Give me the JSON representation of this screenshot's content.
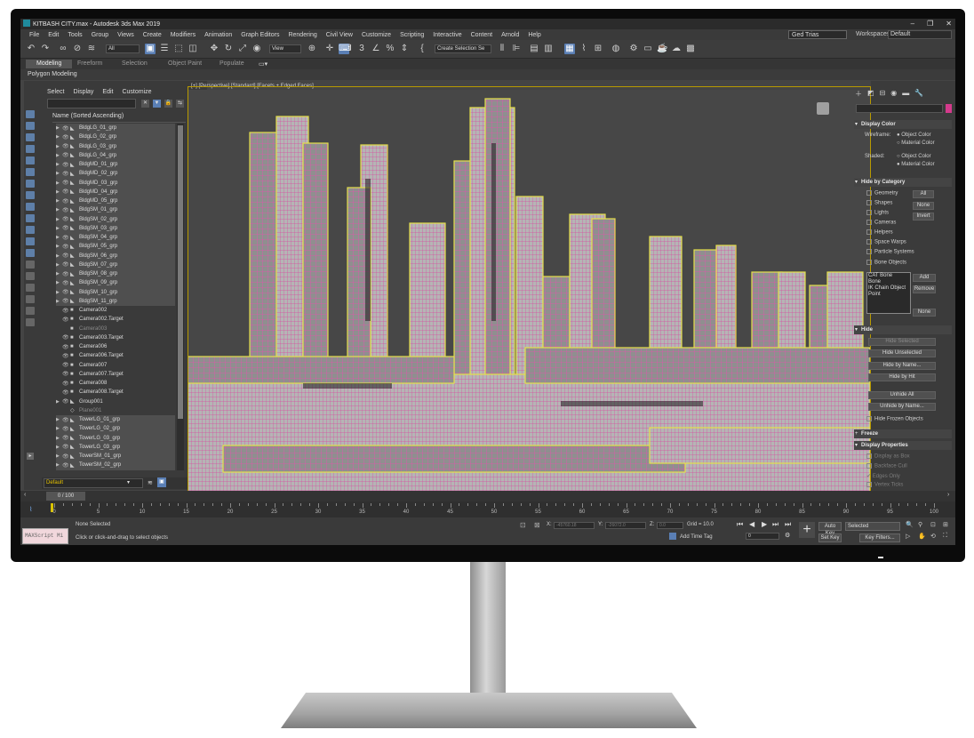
{
  "app": {
    "title": "KITBASH CITY.max - Autodesk 3ds Max 2019"
  },
  "menu": [
    "File",
    "Edit",
    "Tools",
    "Group",
    "Views",
    "Create",
    "Modifiers",
    "Animation",
    "Graph Editors",
    "Rendering",
    "Civil View",
    "Customize",
    "Scripting",
    "Interactive",
    "Content",
    "Arnold",
    "Help"
  ],
  "user": {
    "name": "Ged Trias",
    "workspaces_label": "Workspaces:",
    "workspace": "Default"
  },
  "toolbar": {
    "filter": "All",
    "refcoord": "View",
    "selection_set": "Create Selection Se"
  },
  "ribbon": {
    "tabs": [
      "Modeling",
      "Freeform",
      "Selection",
      "Object Paint",
      "Populate"
    ],
    "active": "Modeling",
    "sub": "Polygon Modeling"
  },
  "explorer": {
    "menu": [
      "Select",
      "Display",
      "Edit",
      "Customize"
    ],
    "header": "Name (Sorted Ascending)",
    "items": [
      "BldgLG_01_grp",
      "BldgLG_02_grp",
      "BldgLG_03_grp",
      "BldgLG_04_grp",
      "BldgMD_01_grp",
      "BldgMD_02_grp",
      "BldgMD_03_grp",
      "BldgMD_04_grp",
      "BldgMD_05_grp",
      "BldgSM_01_grp",
      "BldgSM_02_grp",
      "BldgSM_03_grp",
      "BldgSM_04_grp",
      "BldgSM_05_grp",
      "BldgSM_06_grp",
      "BldgSM_07_grp",
      "BldgSM_08_grp",
      "BldgSM_09_grp",
      "BldgSM_10_grp",
      "BldgSM_11_grp",
      "Camera002",
      "Camera002.Target",
      "Camera003",
      "Camera003.Target",
      "Camera006",
      "Camera006.Target",
      "Camera007",
      "Camera007.Target",
      "Camera008",
      "Camera008.Target",
      "Group001",
      "Plane001",
      "TowerLG_01_grp",
      "TowerLG_02_grp",
      "TowerLG_03_grp",
      "TowerLG_03_grp",
      "TowerSM_01_grp",
      "TowerSM_02_grp"
    ],
    "layer": "Default"
  },
  "viewport": {
    "label": "[+] [Perspective] [Standard] [Facets + Edged Faces]"
  },
  "command_panel": {
    "display_color": {
      "title": "Display Color",
      "wireframe_label": "Wireframe:",
      "shaded_label": "Shaded:",
      "object_color": "Object Color",
      "material_color": "Material Color"
    },
    "hide_by_category": {
      "title": "Hide by Category",
      "items": [
        "Geometry",
        "Shapes",
        "Lights",
        "Cameras",
        "Helpers",
        "Space Warps",
        "Particle Systems",
        "Bone Objects"
      ],
      "btn_all": "All",
      "btn_none": "None",
      "btn_invert": "Invert",
      "list": [
        "CAT Bone",
        "Bone",
        "IK Chain Object",
        "Point"
      ],
      "btn_add": "Add",
      "btn_remove": "Remove",
      "btn_none2": "None"
    },
    "hide": {
      "title": "Hide",
      "buttons": [
        "Hide Selected",
        "Hide Unselected",
        "Hide by Name...",
        "Hide by Hit",
        "Unhide All",
        "Unhide by Name..."
      ],
      "frozen": "Hide Frozen Objects"
    },
    "freeze": {
      "title": "Freeze"
    },
    "display_properties": {
      "title": "Display Properties",
      "items": [
        "Display as Box",
        "Backface Cull",
        "Edges Only",
        "Vertex Ticks"
      ]
    }
  },
  "timeline": {
    "slider": "0 / 100",
    "ticks": [
      "0",
      "5",
      "10",
      "15",
      "20",
      "25",
      "30",
      "35",
      "40",
      "45",
      "50",
      "55",
      "60",
      "65",
      "70",
      "75",
      "80",
      "85",
      "90",
      "95",
      "100"
    ]
  },
  "status": {
    "maxscript": "MAXScript Mi",
    "selected": "None Selected",
    "prompt": "Click or click-and-drag to select objects",
    "x_label": "X:",
    "y_label": "Y:",
    "z_label": "Z:",
    "x": "-45760.18",
    "y": "-26072.0",
    "z": "0.0",
    "grid": "Grid = 10.0",
    "add_time_tag": "Add Time Tag",
    "frame": "0",
    "auto_key": "Auto Key",
    "set_key": "Set Key",
    "key_mode": "Selected",
    "key_filters": "Key Filters..."
  }
}
